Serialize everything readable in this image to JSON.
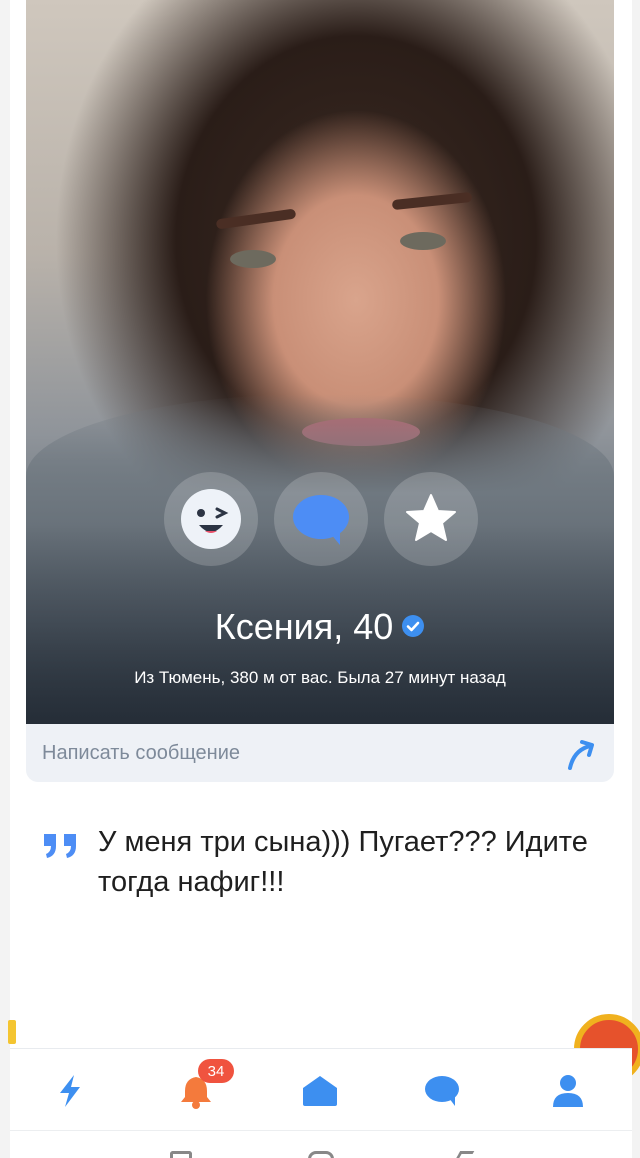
{
  "profile": {
    "name": "Ксения, 40",
    "details": "Из Тюмень, 380 м от вас. Была 27 минут назад",
    "verified": true
  },
  "actions": [
    {
      "icon": "wink-emoji-icon"
    },
    {
      "icon": "chat-bubble-icon"
    },
    {
      "icon": "star-icon"
    }
  ],
  "message_bar": {
    "placeholder": "Написать сообщение",
    "send_icon": "send-arrow-icon"
  },
  "quote": {
    "icon": "quote-marks-icon",
    "text": "У меня три сына))) Пугает??? Идите тогда нафиг!!!"
  },
  "bottom_nav": {
    "items": [
      {
        "icon": "lightning-icon"
      },
      {
        "icon": "bell-icon",
        "badge": "34"
      },
      {
        "icon": "home-icon"
      },
      {
        "icon": "chat-icon"
      },
      {
        "icon": "profile-icon"
      }
    ]
  },
  "colors": {
    "accent": "#3d8ff0",
    "badge": "#f0533f",
    "action_bg": "rgba(255,255,255,0.18)",
    "message_bar_bg": "#eef1f6"
  }
}
